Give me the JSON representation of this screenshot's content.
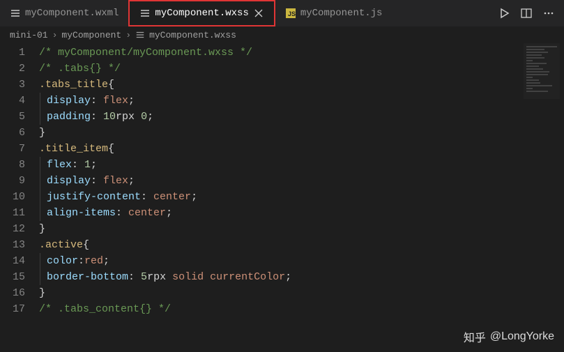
{
  "tabs": [
    {
      "label": "myComponent.wxml",
      "icon": "wxml"
    },
    {
      "label": "myComponent.wxss",
      "icon": "wxss",
      "active": true,
      "closeable": true
    },
    {
      "label": "myComponent.js",
      "icon": "js"
    }
  ],
  "breadcrumb": {
    "p0": "mini-01",
    "p1": "myComponent",
    "p2": "myComponent.wxss"
  },
  "lines": {
    "num1": "1",
    "t1a": "/* myComponent/myComponent.wxss */",
    "num2": "2",
    "t2a": "/* .tabs{} */",
    "num3": "3",
    "sel3": ".tabs_title",
    "brace3": "{",
    "num4": "4",
    "prop4": "display",
    "val4": "flex",
    "num5": "5",
    "prop5": "padding",
    "val5a": "10",
    "val5u1": "rpx",
    "val5b": " 0",
    "num6": "6",
    "brace6": "}",
    "num7": "7",
    "sel7": ".title_item",
    "brace7": "{",
    "num8": "8",
    "prop8": "flex",
    "val8": "1",
    "num9": "9",
    "prop9": "display",
    "val9": "flex",
    "num10": "10",
    "prop10": "justify-content",
    "val10": "center",
    "num11": "11",
    "prop11": "align-items",
    "val11": "center",
    "num12": "12",
    "brace12": "}",
    "num13": "13",
    "sel13": ".active",
    "brace13": "{",
    "num14": "14",
    "prop14": "color",
    "val14": "red",
    "num15": "15",
    "prop15": "border-bottom",
    "val15a": "5",
    "val15u": "rpx",
    "val15b": " solid currentColor",
    "num16": "16",
    "brace16": "}",
    "num17": "17",
    "t17a": "/* .tabs_content{} */"
  },
  "watermark": {
    "brand": "知乎",
    "user": "@LongYorke"
  }
}
